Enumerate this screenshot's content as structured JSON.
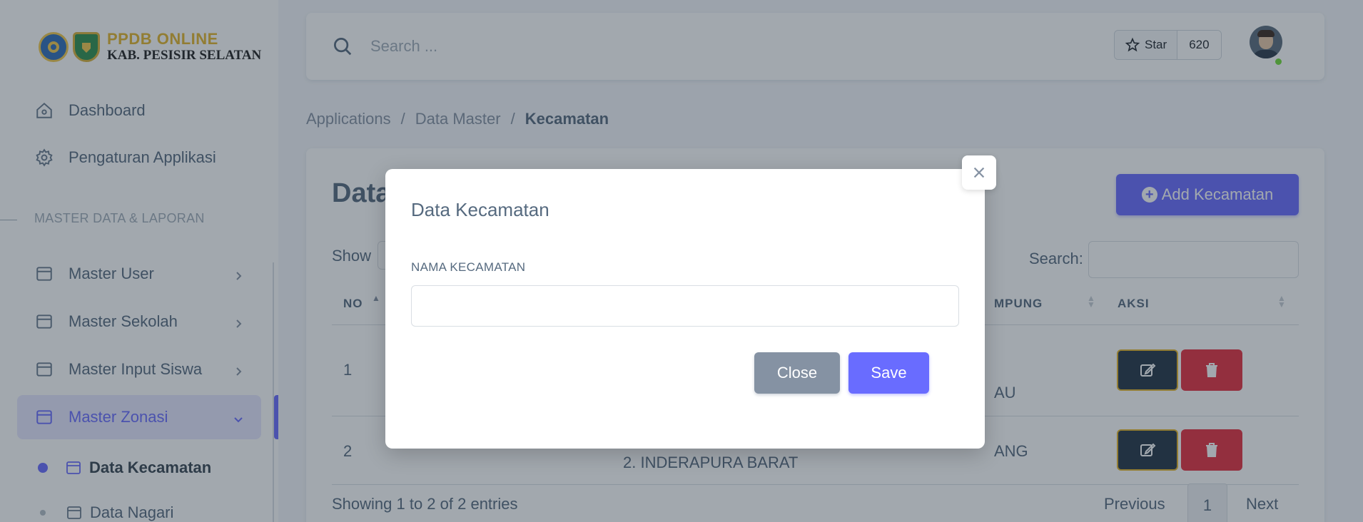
{
  "brand": {
    "line1": "PPDB ONLINE",
    "line2": "KAB. PESISIR SELATAN"
  },
  "sidebar": {
    "items": [
      {
        "label": "Dashboard",
        "icon": "home-icon"
      },
      {
        "label": "Pengaturan Applikasi",
        "icon": "gear-icon"
      }
    ],
    "section_header": "MASTER DATA & LAPORAN",
    "master_items": [
      {
        "label": "Master User",
        "icon": "window-icon"
      },
      {
        "label": "Master Sekolah",
        "icon": "window-icon"
      },
      {
        "label": "Master Input Siswa",
        "icon": "window-icon"
      },
      {
        "label": "Master Zonasi",
        "icon": "window-icon"
      }
    ],
    "sub_items": [
      {
        "label": "Data Kecamatan"
      },
      {
        "label": "Data Nagari"
      }
    ]
  },
  "navbar": {
    "search_placeholder": "Search ...",
    "star_label": "Star",
    "star_count": "620"
  },
  "breadcrumb": {
    "items": [
      "Applications",
      "/",
      "Data Master",
      "/",
      "Kecamatan"
    ]
  },
  "card": {
    "title": "Data",
    "add_button": "Add Kecamatan",
    "show_label": "Show",
    "search_label": "Search:",
    "columns": [
      "NO",
      "MPUNG",
      "AKSI"
    ],
    "rows": [
      {
        "no": "1",
        "partial": "AU"
      },
      {
        "no": "2",
        "col2": "2. INDERAPURA BARAT",
        "partial": "ANG"
      }
    ],
    "footer_info": "Showing 1 to 2 of 2 entries",
    "pagination": {
      "previous": "Previous",
      "current": "1",
      "next": "Next"
    }
  },
  "modal": {
    "title": "Data Kecamatan",
    "field_label": "NAMA KECAMATAN",
    "field_value": "",
    "close_label": "Close",
    "save_label": "Save"
  },
  "colors": {
    "primary": "#696cff",
    "secondary": "#8592a3",
    "danger": "#e6303f",
    "dark": "#233446",
    "brand_gold": "#e3b62b"
  }
}
